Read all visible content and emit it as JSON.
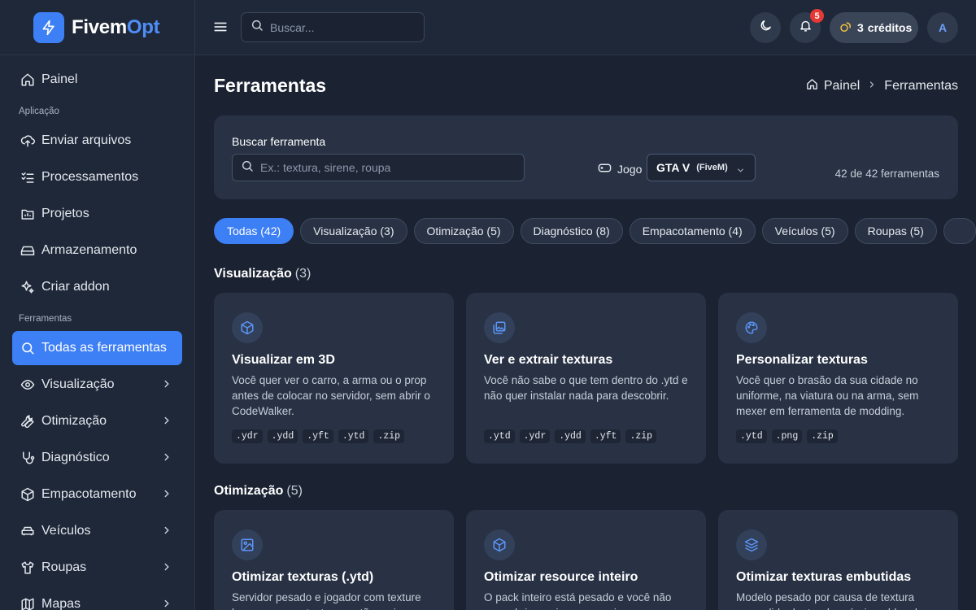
{
  "brand": {
    "name_main": "Fivem",
    "name_accent": "Opt"
  },
  "topbar": {
    "search_placeholder": "Buscar...",
    "notifications_count": "5",
    "credits_value": "3",
    "credits_label": "créditos",
    "avatar_initial": "A"
  },
  "sidebar": {
    "dashboard": "Painel",
    "section_app": "Aplicação",
    "app_items": [
      "Enviar arquivos",
      "Processamentos",
      "Projetos",
      "Armazenamento",
      "Criar addon"
    ],
    "section_tools": "Ferramentas",
    "tool_items": [
      "Todas as ferramentas",
      "Visualização",
      "Otimização",
      "Diagnóstico",
      "Empacotamento",
      "Veículos",
      "Roupas",
      "Mapas"
    ]
  },
  "page": {
    "title": "Ferramentas",
    "breadcrumb": [
      "Painel",
      "Ferramentas"
    ]
  },
  "filters": {
    "search_label": "Buscar ferramenta",
    "search_placeholder": "Ex.: textura, sirene, roupa",
    "game_label": "Jogo",
    "game_value": "GTA V",
    "game_sub": "(FiveM)",
    "count_text": "42 de 42 ferramentas"
  },
  "chips": [
    "Todas (42)",
    "Visualização (3)",
    "Otimização (5)",
    "Diagnóstico (8)",
    "Empacotamento (4)",
    "Veículos (5)",
    "Roupas (5)",
    ""
  ],
  "sections": [
    {
      "name": "Visualização",
      "count": "(3)",
      "cards": [
        {
          "icon": "cube-icon",
          "title": "Visualizar em 3D",
          "desc": "Você quer ver o carro, a arma ou o prop antes de colocar no servidor, sem abrir o CodeWalker.",
          "tags": [
            ".ydr",
            ".ydd",
            ".yft",
            ".ytd",
            ".zip"
          ]
        },
        {
          "icon": "images-icon",
          "title": "Ver e extrair texturas",
          "desc": "Você não sabe o que tem dentro do .ytd e não quer instalar nada para descobrir.",
          "tags": [
            ".ytd",
            ".ydr",
            ".ydd",
            ".yft",
            ".zip"
          ]
        },
        {
          "icon": "palette-icon",
          "title": "Personalizar texturas",
          "desc": "Você quer o brasão da sua cidade no uniforme, na viatura ou na arma, sem mexer em ferramenta de modding.",
          "tags": [
            ".ytd",
            ".png",
            ".zip"
          ]
        }
      ]
    },
    {
      "name": "Otimização",
      "count": "(5)",
      "cards": [
        {
          "icon": "image-icon",
          "title": "Otimizar texturas (.ytd)",
          "desc": "Servidor pesado e jogador com texture loss porque as texturas estão maiores",
          "tags": []
        },
        {
          "icon": "cube-icon",
          "title": "Otimizar resource inteiro",
          "desc": "O pack inteiro está pesado e você não quer abrir arquivo por arquivo.",
          "tags": []
        },
        {
          "icon": "layers-icon",
          "title": "Otimizar texturas embutidas",
          "desc": "Modelo pesado por causa de textura escondida dentro do próprio .ydd, .ydr",
          "tags": []
        }
      ]
    }
  ],
  "colors": {
    "accent": "#3d7ff5",
    "background": "#1b2332",
    "panel": "#283244",
    "badge": "#e53935"
  }
}
